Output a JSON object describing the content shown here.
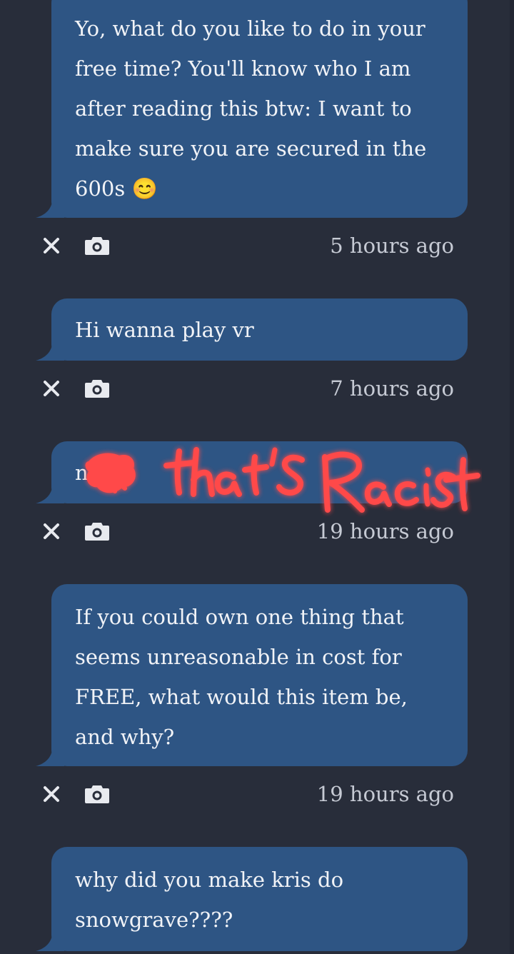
{
  "messages": [
    {
      "text": "Yo, what do you like to do in your\nfree time? You'll know who I am\nafter reading this btw: I want to\nmake sure you are secured in the\n600s",
      "emoji": "😊",
      "time": "5 hours ago"
    },
    {
      "text": "Hi wanna play vr",
      "time": "7 hours ago"
    },
    {
      "text": "n",
      "time": "19 hours ago",
      "scribble_annotation": "that's Racist"
    },
    {
      "text": "If you could own one thing that\nseems unreasonable in cost for\nFREE, what would this item be,\nand why?",
      "time": "19 hours ago"
    },
    {
      "text": "why did you make kris do\nsnowgrave????"
    }
  ],
  "icons": {
    "delete": "close-icon",
    "screenshot": "camera-icon"
  },
  "colors": {
    "background": "#282d3a",
    "bubble": "#2e5584",
    "text": "#f1f3f7",
    "timestamp": "#c6cad4",
    "scribble": "#ff4a4a"
  }
}
